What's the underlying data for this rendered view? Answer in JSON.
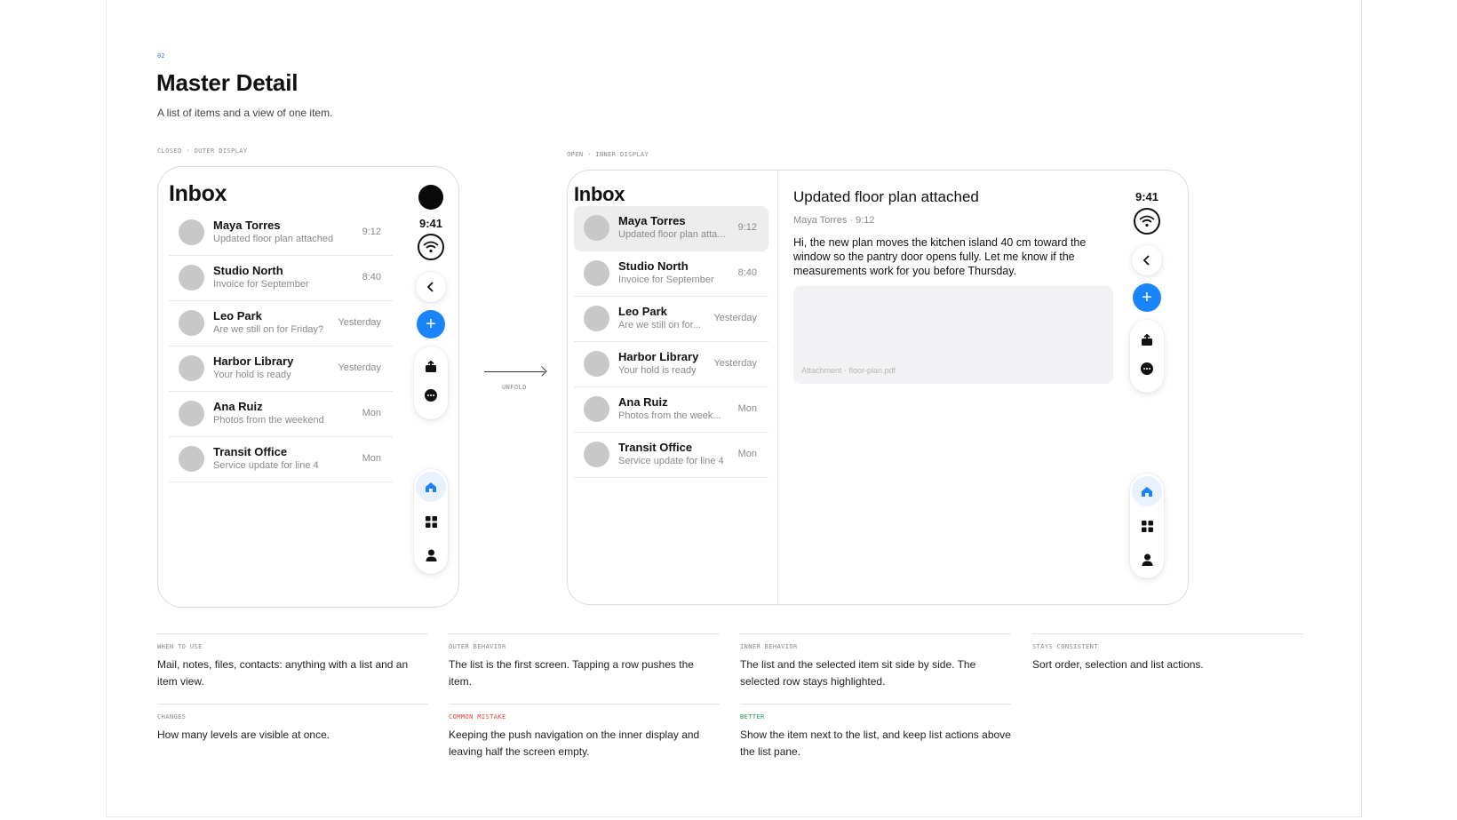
{
  "section": {
    "number": "02",
    "title": "Master Detail",
    "subtitle": "A list of items and a view of one item."
  },
  "captions": {
    "closed": "CLOSED · OUTER DISPLAY",
    "open": "OPEN · INNER DISPLAY",
    "transition": "UNFOLD"
  },
  "outer": {
    "heading": "Inbox",
    "clock": "9:41",
    "messages": [
      {
        "name": "Maya Torres",
        "preview": "Updated floor plan attached",
        "time": "9:12"
      },
      {
        "name": "Studio North",
        "preview": "Invoice for September",
        "time": "8:40"
      },
      {
        "name": "Leo Park",
        "preview": "Are we still on for Friday?",
        "time": "Yesterday"
      },
      {
        "name": "Harbor Library",
        "preview": "Your hold is ready",
        "time": "Yesterday"
      },
      {
        "name": "Ana Ruiz",
        "preview": "Photos from the weekend",
        "time": "Mon"
      },
      {
        "name": "Transit Office",
        "preview": "Service update for line 4",
        "time": "Mon"
      }
    ],
    "icons": [
      "camera-cutout",
      "wifi-icon",
      "back-icon",
      "plus-icon",
      "share-icon",
      "more-icon",
      "home-icon",
      "grid-icon",
      "person-icon"
    ]
  },
  "inner": {
    "heading": "Inbox",
    "clock": "9:41",
    "messages": [
      {
        "name": "Maya Torres",
        "preview": "Updated floor plan atta...",
        "time": "9:12",
        "selected": true
      },
      {
        "name": "Studio North",
        "preview": "Invoice for September",
        "time": "8:40"
      },
      {
        "name": "Leo Park",
        "preview": "Are we still on for...",
        "time": "Yesterday"
      },
      {
        "name": "Harbor Library",
        "preview": "Your hold is ready",
        "time": "Yesterday"
      },
      {
        "name": "Ana Ruiz",
        "preview": "Photos from the week...",
        "time": "Mon"
      },
      {
        "name": "Transit Office",
        "preview": "Service update for line 4",
        "time": "Mon"
      }
    ],
    "detail": {
      "title": "Updated floor plan attached",
      "meta": "Maya Torres · 9:12",
      "body": "Hi, the new plan moves the kitchen island 40 cm toward the window so the pantry door opens fully. Let me know if the measurements work for you before Thursday.",
      "attachment": "Attachment · floor-plan.pdf"
    }
  },
  "notes": [
    {
      "label": "WHEN TO USE",
      "text": "Mail, notes, files, contacts: anything with a list and an item view."
    },
    {
      "label": "OUTER BEHAVIOR",
      "text": "The list is the first screen. Tapping a row pushes the item."
    },
    {
      "label": "INNER BEHAVIOR",
      "text": "The list and the selected item sit side by side. The selected row stays highlighted."
    },
    {
      "label": "STAYS CONSISTENT",
      "text": "Sort order, selection and list actions."
    },
    {
      "label": "CHANGES",
      "text": "How many levels are visible at once."
    },
    {
      "label": "COMMON MISTAKE",
      "text": "Keeping the push navigation on the inner display and leaving half the screen empty.",
      "tone": "red"
    },
    {
      "label": "BETTER",
      "text": "Show the item next to the list, and keep list actions above the list pane.",
      "tone": "green"
    }
  ],
  "colors": {
    "accent": "#1a84ff",
    "mistake": "#d9453b",
    "better": "#1f9a4a",
    "selected_row": "#ededed"
  }
}
